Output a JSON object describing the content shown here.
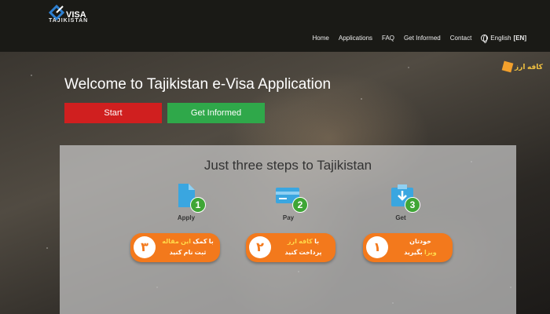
{
  "header": {
    "logo_text": "VISA",
    "logo_sub": "TAJIKISTAN",
    "nav": [
      "Home",
      "Applications",
      "FAQ",
      "Get Informed",
      "Contact"
    ],
    "language": "English",
    "language_code": "[EN]"
  },
  "hero": {
    "welcome": "Welcome to Tajikistan e-Visa Application",
    "start_label": "Start",
    "info_label": "Get Informed"
  },
  "steps": {
    "title": "Just three steps to Tajikistan",
    "items": [
      {
        "num": "1",
        "label": "Apply"
      },
      {
        "num": "2",
        "label": "Pay"
      },
      {
        "num": "3",
        "label": "Get"
      }
    ]
  },
  "badges": [
    {
      "num": "۳",
      "line1a": "با کمک",
      "line1b": "این مقاله",
      "line2": "ثبت نام کنید"
    },
    {
      "num": "۲",
      "line1a": "با",
      "line1b": "کافه ارز",
      "line2": "پرداخت کنید"
    },
    {
      "num": "۱",
      "line1a": "خودتان",
      "line1b": "ویزا",
      "line2": "بگیرید"
    }
  ],
  "side_logo": "کافه ارز",
  "colors": {
    "start": "#d01f1f",
    "info": "#2fa84a",
    "step_green": "#3fa636",
    "badge_orange": "#f3791c",
    "icon_blue": "#3aa6e0"
  }
}
